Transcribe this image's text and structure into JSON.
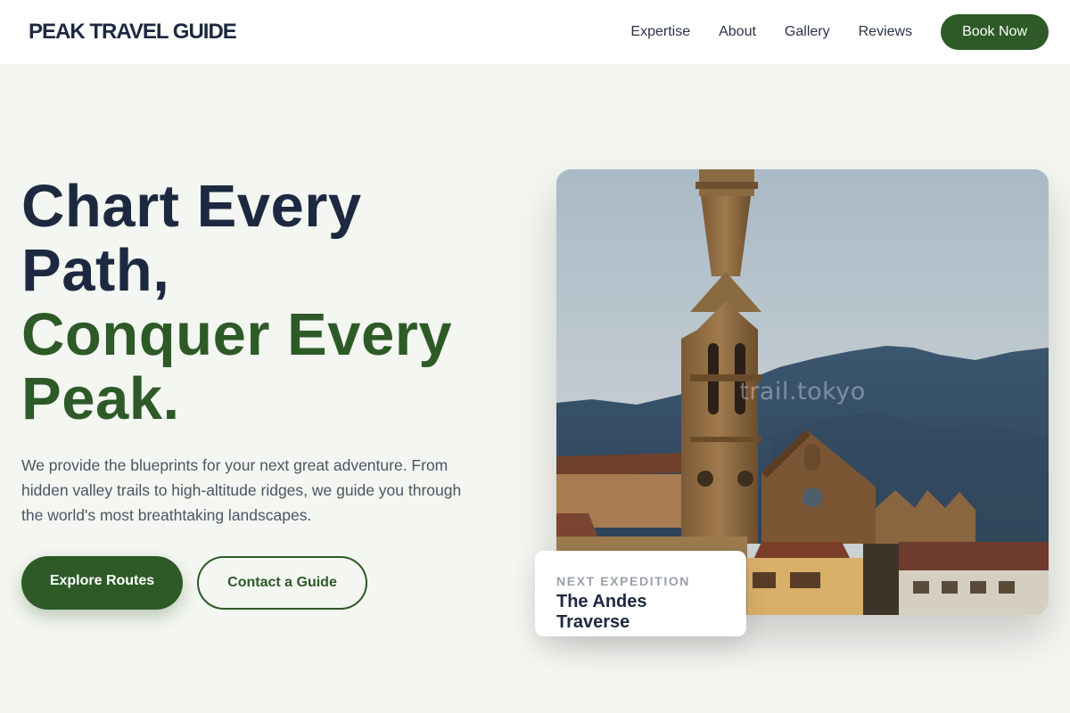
{
  "brand": {
    "logo": "PEAK TRAVEL GUIDE"
  },
  "nav": {
    "items": [
      "Expertise",
      "About",
      "Gallery",
      "Reviews"
    ],
    "cta": "Book Now"
  },
  "hero": {
    "title_line1": "Chart Every",
    "title_line2": "Path,",
    "title_line3": "Conquer Every",
    "title_line4": "Peak.",
    "description": "We provide the blueprints for your next great adventure. From hidden valley trails to high-altitude ridges, we guide you through the world's most breathtaking landscapes.",
    "primary_button": "Explore Routes",
    "secondary_button": "Contact a Guide"
  },
  "image": {
    "watermark": "trail.tokyo"
  },
  "expedition_card": {
    "label": "NEXT EXPEDITION",
    "title": "The Andes Traverse"
  },
  "colors": {
    "accent_green": "#2d5a27",
    "heading_navy": "#1c2940",
    "background": "#f3f6f1"
  }
}
